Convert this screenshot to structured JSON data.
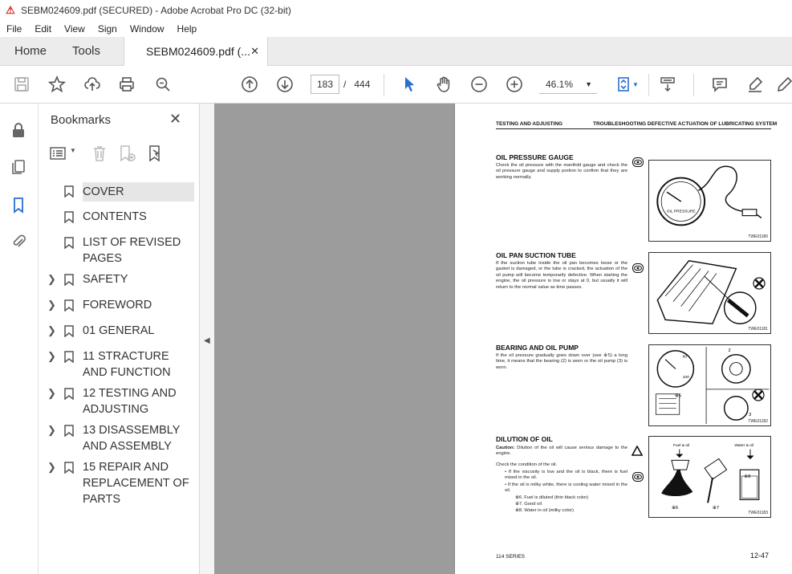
{
  "window": {
    "title": "SEBM024609.pdf (SECURED) - Adobe Acrobat Pro DC (32-bit)"
  },
  "menu": [
    "File",
    "Edit",
    "View",
    "Sign",
    "Window",
    "Help"
  ],
  "tabs": {
    "home": "Home",
    "tools": "Tools",
    "document": "SEBM024609.pdf (..."
  },
  "toolbar": {
    "current_page": "183",
    "page_separator": "/",
    "total_pages": "444",
    "zoom": "46.1%"
  },
  "bookmarks_panel": {
    "title": "Bookmarks",
    "items": [
      {
        "label": "COVER",
        "expandable": false,
        "selected": true
      },
      {
        "label": "CONTENTS",
        "expandable": false
      },
      {
        "label": "LIST OF REVISED PAGES",
        "expandable": false
      },
      {
        "label": "SAFETY",
        "expandable": true
      },
      {
        "label": "FOREWORD",
        "expandable": true
      },
      {
        "label": "01 GENERAL",
        "expandable": true
      },
      {
        "label": "11 STRACTURE AND FUNCTION",
        "expandable": true
      },
      {
        "label": "12 TESTING AND ADJUSTING",
        "expandable": true
      },
      {
        "label": "13 DISASSEMBLY AND ASSEMBLY",
        "expandable": true
      },
      {
        "label": "15 REPAIR AND REPLACEMENT OF PARTS",
        "expandable": true
      }
    ]
  },
  "document_page": {
    "header_left": "TESTING AND ADJUSTING",
    "header_right": "TROUBLESHOOTING DEFECTIVE ACTUATION OF LUBRICATING SYSTEM",
    "sections": [
      {
        "title": "OIL PRESSURE GAUGE",
        "text": "Check the oil pressure with the manifold gauge and check the oil pressure gauge and supply portion to confirm that they are working normally.",
        "figure_tag": "TWE01180"
      },
      {
        "title": "OIL PAN SUCTION TUBE",
        "text": "If the suction tube inside the oil pan becomes loose or the gasket is damaged, or the tube is cracked, the actuation of the oil pump will become temporarily defective. When starting the engine, the oil pressure is low or stays at 0, but usually it will return to the normal value as time passes.",
        "figure_tag": "TWE01181"
      },
      {
        "title": "BEARING AND OIL PUMP",
        "text": "If the oil pressure gradually goes down over (see ※5) a long time, it means that the bearing (2) is worn or the oil pump (3) is worn.",
        "figure_tag": "TWE01182"
      },
      {
        "title": "DILUTION OF OIL",
        "caution_label": "Caution:",
        "caution_text": "Dilution of the oil will cause serious damage to the engine.",
        "check_text": "Check the condition of the oil.",
        "bullets": [
          "If the viscosity is low and the oil is black, there is fuel mixed in the oil.",
          "If the oil is milky white, there is cooling water mixed in the oil."
        ],
        "notes": [
          "※6.  Fuel is diluted (thin black color)",
          "※7.  Good oil",
          "※8.  Water in oil (milky color)"
        ],
        "figure_labels": {
          "fuel_oil": "Fuel & oil",
          "water_oil": "Water & oil",
          "n6": "※6",
          "n7": "※7",
          "n8": "※8"
        },
        "figure_tag": "TWE01183"
      }
    ],
    "gauge_label": "OIL PRESSURE",
    "gauge_numbers": {
      "a": "60",
      "b": "100"
    },
    "callouts": {
      "c2": "2",
      "c3": "3",
      "c5": "※5"
    },
    "footer_left": "114 SERIES",
    "footer_right": "12-47"
  }
}
